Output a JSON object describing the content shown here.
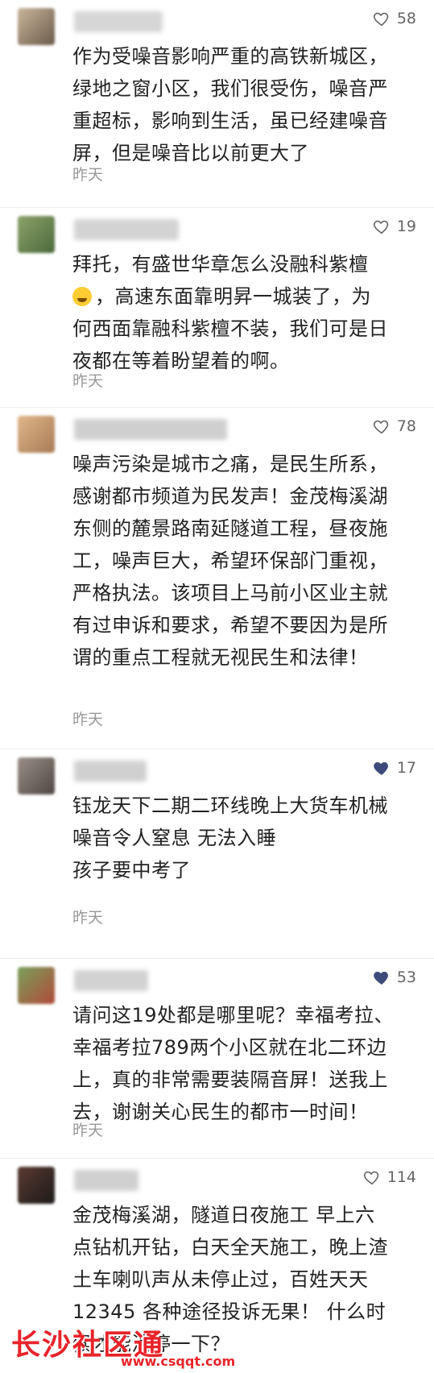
{
  "comments": [
    {
      "likes": "58",
      "liked": false,
      "text": "作为受噪音影响严重的高铁新城区，\n绿地之窗小区，我们很受伤，噪音严\n重超标，影响到生活，虽已经建噪音\n屏，但是噪音比以前更大了",
      "time": "昨天"
    },
    {
      "likes": "19",
      "liked": false,
      "text_before_emoji": "拜托，有盛世华章怎么没融科紫檀\n",
      "text_after_emoji": "，高速东面靠明昇一城装了，为\n何西面靠融科紫檀不装，我们可是日\n夜都在等着盼望着的啊。",
      "time": "昨天"
    },
    {
      "likes": "78",
      "liked": false,
      "text": "噪声污染是城市之痛，是民生所系，\n感谢都市频道为民发声！金茂梅溪湖\n东侧的麓景路南延隧道工程，昼夜施\n工，噪声巨大，希望环保部门重视，\n严格执法。该项目上马前小区业主就\n有过申诉和要求，希望不要因为是所\n谓的重点工程就无视民生和法律！",
      "time": "昨天"
    },
    {
      "likes": "17",
      "liked": true,
      "text": "钰龙天下二期二环线晚上大货车机械\n噪音令人窒息 无法入睡\n孩子要中考了",
      "time": "昨天"
    },
    {
      "likes": "53",
      "liked": true,
      "text": "请问这19处都是哪里呢？幸福考拉、\n幸福考拉789两个小区就在北二环边\n上，真的非常需要装隔音屏！送我上\n去，谢谢关心民生的都市一时间！",
      "time": "昨天"
    },
    {
      "likes": "114",
      "liked": false,
      "text": "金茂梅溪湖，隧道日夜施工 早上六\n点钻机开钻，白天全天施工，晚上渣\n土车喇叭声从未停止过，百姓天天\n12345 各种途径投诉无果！ 什么时\n候才能消停一下？",
      "time": ""
    }
  ],
  "watermark": {
    "name": "长沙社区通",
    "url": "www.csqqt.com"
  },
  "colors": {
    "heart_outline": "#666666",
    "heart_filled": "#3d4a7a",
    "watermark": "#e8232a"
  }
}
